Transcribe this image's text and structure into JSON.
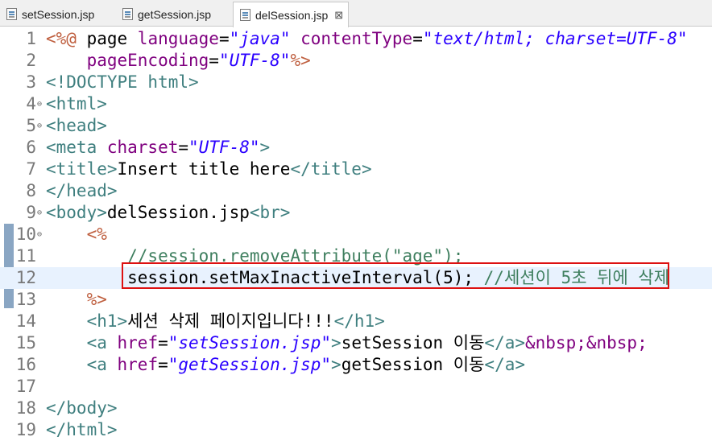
{
  "tabs": [
    {
      "label": "setSession.jsp",
      "active": false
    },
    {
      "label": "getSession.jsp",
      "active": false
    },
    {
      "label": "delSession.jsp",
      "active": true,
      "close": "⊠"
    }
  ],
  "folds": {
    "l4": "⊖",
    "l5": "⊖",
    "l9": "⊖",
    "l10": "⊖"
  },
  "lines": [
    {
      "n": "1",
      "parts": {
        "a": "<%@",
        "b": " page ",
        "c": "language",
        "d": "=",
        "e": "\"java\"",
        "f": " ",
        "g": "contentType",
        "h": "=",
        "i": "\"text/html; charset=UTF-8\""
      }
    },
    {
      "n": "2",
      "parts": {
        "a": "    ",
        "b": "pageEncoding",
        "c": "=",
        "d": "\"UTF-8\"",
        "e": "%>"
      }
    },
    {
      "n": "3",
      "parts": {
        "a": "<!DOCTYPE html>"
      }
    },
    {
      "n": "4",
      "parts": {
        "a": "<html>"
      }
    },
    {
      "n": "5",
      "parts": {
        "a": "<head>"
      }
    },
    {
      "n": "6",
      "parts": {
        "a": "<meta ",
        "b": "charset",
        "c": "=",
        "d": "\"UTF-8\"",
        "e": ">"
      }
    },
    {
      "n": "7",
      "parts": {
        "a": "<title>",
        "b": "Insert title here",
        "c": "</title>"
      }
    },
    {
      "n": "8",
      "parts": {
        "a": "</head>"
      }
    },
    {
      "n": "9",
      "parts": {
        "a": "<body>",
        "b": "delSession.jsp",
        "c": "<br>"
      }
    },
    {
      "n": "10",
      "parts": {
        "a": "    <%"
      }
    },
    {
      "n": "11",
      "parts": {
        "a": "        //session.removeAttribute(\"age\");"
      }
    },
    {
      "n": "12",
      "parts": {
        "a": "        session.setMaxInactiveInterval(5); ",
        "b": "//세션이 5초 뒤에 삭제"
      }
    },
    {
      "n": "13",
      "parts": {
        "a": "    %>"
      }
    },
    {
      "n": "14",
      "parts": {
        "a": "    <h1>",
        "b": "세션 삭제 페이지입니다!!!",
        "c": "</h1>"
      }
    },
    {
      "n": "15",
      "parts": {
        "a": "    <a ",
        "b": "href",
        "c": "=",
        "d": "\"setSession.jsp\"",
        "e": ">",
        "f": "setSession 이동",
        "g": "</a>",
        "h": "&nbsp;&nbsp;"
      }
    },
    {
      "n": "16",
      "parts": {
        "a": "    <a ",
        "b": "href",
        "c": "=",
        "d": "\"getSession.jsp\"",
        "e": ">",
        "f": "getSession 이동",
        "g": "</a>"
      }
    },
    {
      "n": "17",
      "parts": {}
    },
    {
      "n": "18",
      "parts": {
        "a": "</body>"
      }
    },
    {
      "n": "19",
      "parts": {
        "a": "</html>"
      }
    }
  ],
  "colors": {
    "tag": "#3f7f7f",
    "attr": "#7f007f",
    "string": "#2a00ff",
    "comment": "#3f7f5f",
    "directive": "#bf5f3f",
    "current_line": "#e8f2fe",
    "highlight_box": "#dd1111"
  }
}
